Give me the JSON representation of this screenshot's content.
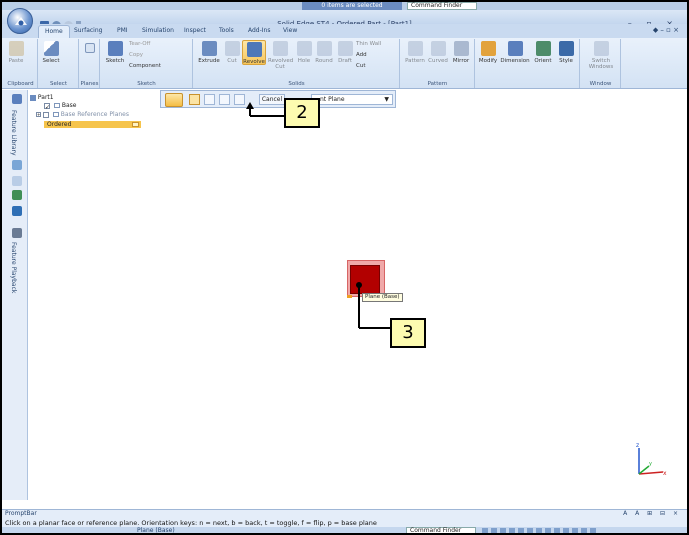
{
  "status_strip": {
    "selection_text": "0 items are selected",
    "command_finder": "Command Finder"
  },
  "window": {
    "title": "Solid Edge ST4 - Ordered Part - [Part1]",
    "controls": "– ▫ ×"
  },
  "tabs": [
    "Home",
    "Surfacing",
    "PMI",
    "Simulation",
    "Inspect",
    "Tools",
    "Add-Ins",
    "View"
  ],
  "tabs_right": "◆ – ▫ ×",
  "ribbon": {
    "groups": {
      "clipboard": "Clipboard",
      "select": "Select",
      "planes": "Planes",
      "sketch": "Sketch",
      "solids": "Solids",
      "pattern": "Pattern",
      "window": "Window"
    },
    "buttons": {
      "paste": "Paste",
      "select": "Select",
      "sketch": "Sketch",
      "tear_off": "Tear-Off",
      "copy": "Copy",
      "component": "Component",
      "extrude": "Extrude",
      "cut": "Cut",
      "revolve": "Revolve",
      "revolved_cut": "Revolved Cut",
      "hole": "Hole",
      "round": "Round",
      "draft": "Draft",
      "thin_wall": "Thin Wall",
      "add": "Add",
      "cut_small": "Cut",
      "pattern": "Pattern",
      "curved": "Curved",
      "mirror": "Mirror",
      "modify": "Modify",
      "dimension": "Dimension",
      "orient": "Orient",
      "style": "Style",
      "switch_windows": "Switch Windows"
    }
  },
  "left_tabs": {
    "feature_library": "Feature Library",
    "feature_playback": "Feature Playback"
  },
  "tree": {
    "root": "Part1",
    "base": "Base",
    "ref_planes": "Base Reference Planes",
    "ordered": "Ordered"
  },
  "command_bar": {
    "cancel": "Cancel",
    "plane_option": "nt Plane"
  },
  "callouts": {
    "step2": "2",
    "step3": "3"
  },
  "viewport": {
    "tooltip": "Plane (Base)"
  },
  "triad": {
    "z": "z",
    "x": "x",
    "y": "y"
  },
  "prompt_bar": {
    "title": "PromptBar",
    "text": "Click on a planar face or reference plane.  Orientation keys:  n = next, b = back, t = toggle, f = flip, p = base plane",
    "buttons": "A A ⊞ ⊟ ×"
  },
  "status_bar": {
    "text": "Plane (Base)",
    "command_finder": "Command Finder"
  }
}
